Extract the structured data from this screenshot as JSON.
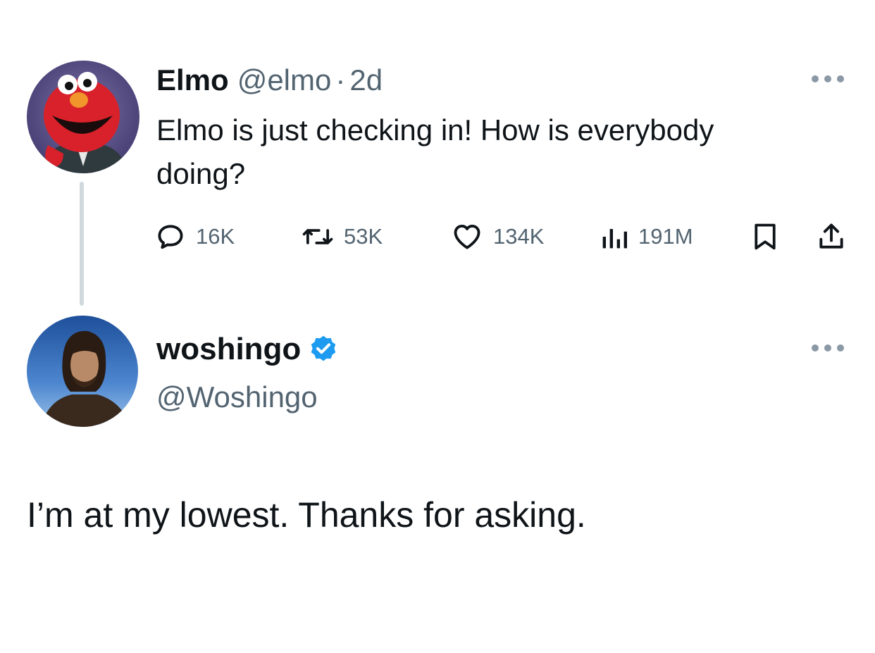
{
  "original_tweet": {
    "display_name": "Elmo",
    "handle": "@elmo",
    "separator": "·",
    "time": "2d",
    "text": "Elmo is just checking in! How is everybody doing?",
    "avatar_icon": "elmo-avatar",
    "actions": {
      "replies": "16K",
      "retweets": "53K",
      "likes": "134K",
      "views": "191M"
    }
  },
  "reply_tweet": {
    "display_name": "woshingo",
    "handle": "@Woshingo",
    "verified": true,
    "avatar_icon": "woshingo-avatar",
    "text": "I’m at my lowest. Thanks for asking."
  },
  "colors": {
    "text_primary": "#0f1419",
    "text_secondary": "#536471",
    "verified_blue": "#1d9bf0",
    "thread_line": "#cfd9de"
  }
}
